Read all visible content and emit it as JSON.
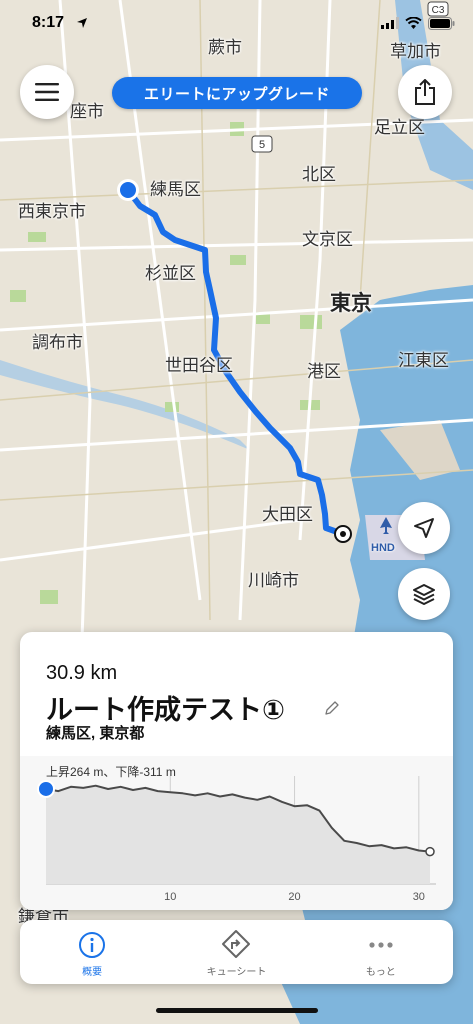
{
  "status_bar": {
    "time": "8:17"
  },
  "map": {
    "labels": {
      "warabi": "蕨市",
      "kawaguchi": "草加市",
      "zashi": "座市",
      "adachi": "足立区",
      "nerima": "練馬区",
      "kita": "北区",
      "nishitokyo": "西東京市",
      "bunkyo": "文京区",
      "suginami": "杉並区",
      "tokyo": "東京",
      "chofu": "調布市",
      "setagaya": "世田谷区",
      "minato": "港区",
      "koto": "江東区",
      "ota": "大田区",
      "kawasaki": "川崎市",
      "kamakura_partial": "鎌倉市",
      "airport": "HND",
      "highway_shield": "5",
      "c3_shield": "C3"
    },
    "colors": {
      "land": "#e9e4d8",
      "water": "#7fb5dc",
      "park": "#b9d99a",
      "route": "#1a6ee8",
      "road": "#ffffff"
    }
  },
  "controls": {
    "upgrade_label": "エリートにアップグレード",
    "menu_icon": "hamburger-icon",
    "share_icon": "share-icon",
    "locate_icon": "navigation-arrow-icon",
    "layers_icon": "layers-icon"
  },
  "route": {
    "distance": "30.9 km",
    "title": "ルート作成テスト①",
    "location": "練馬区, 東京都",
    "elevation_summary": "上昇264 m、下降-311 m"
  },
  "chart_data": {
    "type": "area",
    "xlabel": "",
    "ylabel": "",
    "x_ticks": [
      "10",
      "20",
      "30"
    ],
    "xlim": [
      0,
      30.9
    ],
    "x": [
      0,
      1,
      2,
      3,
      4,
      5,
      6,
      7,
      8,
      9,
      10,
      11,
      12,
      13,
      14,
      15,
      16,
      17,
      18,
      19,
      20,
      21,
      22,
      23,
      24,
      25,
      26,
      27,
      28,
      29,
      30,
      30.9
    ],
    "values": [
      88,
      86,
      90,
      89,
      91,
      88,
      90,
      87,
      89,
      86,
      85,
      84,
      82,
      84,
      81,
      83,
      80,
      78,
      81,
      76,
      72,
      73,
      68,
      52,
      40,
      38,
      35,
      36,
      33,
      34,
      31,
      30
    ],
    "ylim": [
      0,
      100
    ]
  },
  "tabs": [
    {
      "label": "概要",
      "icon": "info-icon",
      "active": true
    },
    {
      "label": "キューシート",
      "icon": "turn-directions-icon",
      "active": false
    },
    {
      "label": "もっと",
      "icon": "more-dots-icon",
      "active": false
    }
  ]
}
